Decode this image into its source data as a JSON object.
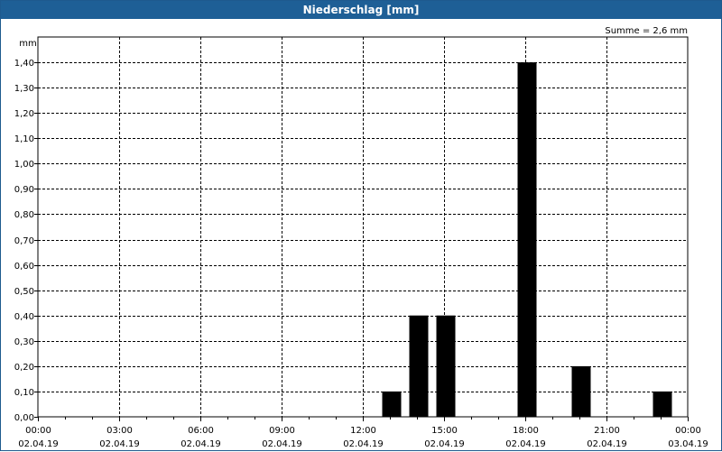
{
  "window": {
    "title": "Niederschlag [mm]"
  },
  "chart_data": {
    "type": "bar",
    "title": "Niederschlag [mm]",
    "ylabel": "mm",
    "annotation": "Summe = 2,6 mm",
    "ylim": [
      0,
      1.5
    ],
    "xlim_hours": [
      0,
      24
    ],
    "grid": true,
    "y_ticks": [
      "0,00",
      "0,10",
      "0,20",
      "0,30",
      "0,40",
      "0,50",
      "0,60",
      "0,70",
      "0,80",
      "0,90",
      "1,00",
      "1,10",
      "1,20",
      "1,30",
      "1,40"
    ],
    "x_ticks": [
      {
        "time": "00:00",
        "date": "02.04.19"
      },
      {
        "time": "03:00",
        "date": "02.04.19"
      },
      {
        "time": "06:00",
        "date": "02.04.19"
      },
      {
        "time": "09:00",
        "date": "02.04.19"
      },
      {
        "time": "12:00",
        "date": "02.04.19"
      },
      {
        "time": "15:00",
        "date": "02.04.19"
      },
      {
        "time": "18:00",
        "date": "02.04.19"
      },
      {
        "time": "21:00",
        "date": "02.04.19"
      },
      {
        "time": "00:00",
        "date": "03.04.19"
      }
    ],
    "bars": [
      {
        "time": "13:00",
        "value": 0.1
      },
      {
        "time": "14:00",
        "value": 0.4
      },
      {
        "time": "15:00",
        "value": 0.4
      },
      {
        "time": "18:00",
        "value": 1.4
      },
      {
        "time": "20:00",
        "value": 0.2
      },
      {
        "time": "23:00",
        "value": 0.1
      }
    ],
    "bar_color": "#000000",
    "grid_color": "#000000"
  }
}
